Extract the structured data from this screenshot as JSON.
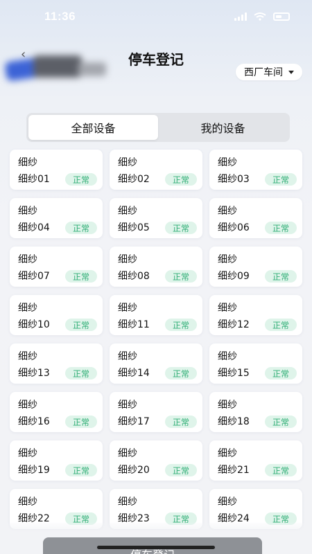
{
  "status_bar": {
    "time": "11:36"
  },
  "header": {
    "back_glyph": "‹",
    "title": "停车登记",
    "workshop": "西厂车间"
  },
  "tabs": [
    {
      "label": "全部设备",
      "active": true
    },
    {
      "label": "我的设备",
      "active": false
    }
  ],
  "devices": [
    {
      "type": "细纱",
      "name": "细纱01",
      "status": "正常"
    },
    {
      "type": "细纱",
      "name": "细纱02",
      "status": "正常"
    },
    {
      "type": "细纱",
      "name": "细纱03",
      "status": "正常"
    },
    {
      "type": "细纱",
      "name": "细纱04",
      "status": "正常"
    },
    {
      "type": "细纱",
      "name": "细纱05",
      "status": "正常"
    },
    {
      "type": "细纱",
      "name": "细纱06",
      "status": "正常"
    },
    {
      "type": "细纱",
      "name": "细纱07",
      "status": "正常"
    },
    {
      "type": "细纱",
      "name": "细纱08",
      "status": "正常"
    },
    {
      "type": "细纱",
      "name": "细纱09",
      "status": "正常"
    },
    {
      "type": "细纱",
      "name": "细纱10",
      "status": "正常"
    },
    {
      "type": "细纱",
      "name": "细纱11",
      "status": "正常"
    },
    {
      "type": "细纱",
      "name": "细纱12",
      "status": "正常"
    },
    {
      "type": "细纱",
      "name": "细纱13",
      "status": "正常"
    },
    {
      "type": "细纱",
      "name": "细纱14",
      "status": "正常"
    },
    {
      "type": "细纱",
      "name": "细纱15",
      "status": "正常"
    },
    {
      "type": "细纱",
      "name": "细纱16",
      "status": "正常"
    },
    {
      "type": "细纱",
      "name": "细纱17",
      "status": "正常"
    },
    {
      "type": "细纱",
      "name": "细纱18",
      "status": "正常"
    },
    {
      "type": "细纱",
      "name": "细纱19",
      "status": "正常"
    },
    {
      "type": "细纱",
      "name": "细纱20",
      "status": "正常"
    },
    {
      "type": "细纱",
      "name": "细纱21",
      "status": "正常"
    },
    {
      "type": "细纱",
      "name": "细纱22",
      "status": "正常"
    },
    {
      "type": "细纱",
      "name": "细纱23",
      "status": "正常"
    },
    {
      "type": "细纱",
      "name": "细纱24",
      "status": "正常"
    }
  ],
  "footer": {
    "submit_label": "停车登记"
  },
  "colors": {
    "status_ok_bg": "#dff4ea",
    "status_ok_text": "#2fae75",
    "button_bg": "#8e9196"
  }
}
